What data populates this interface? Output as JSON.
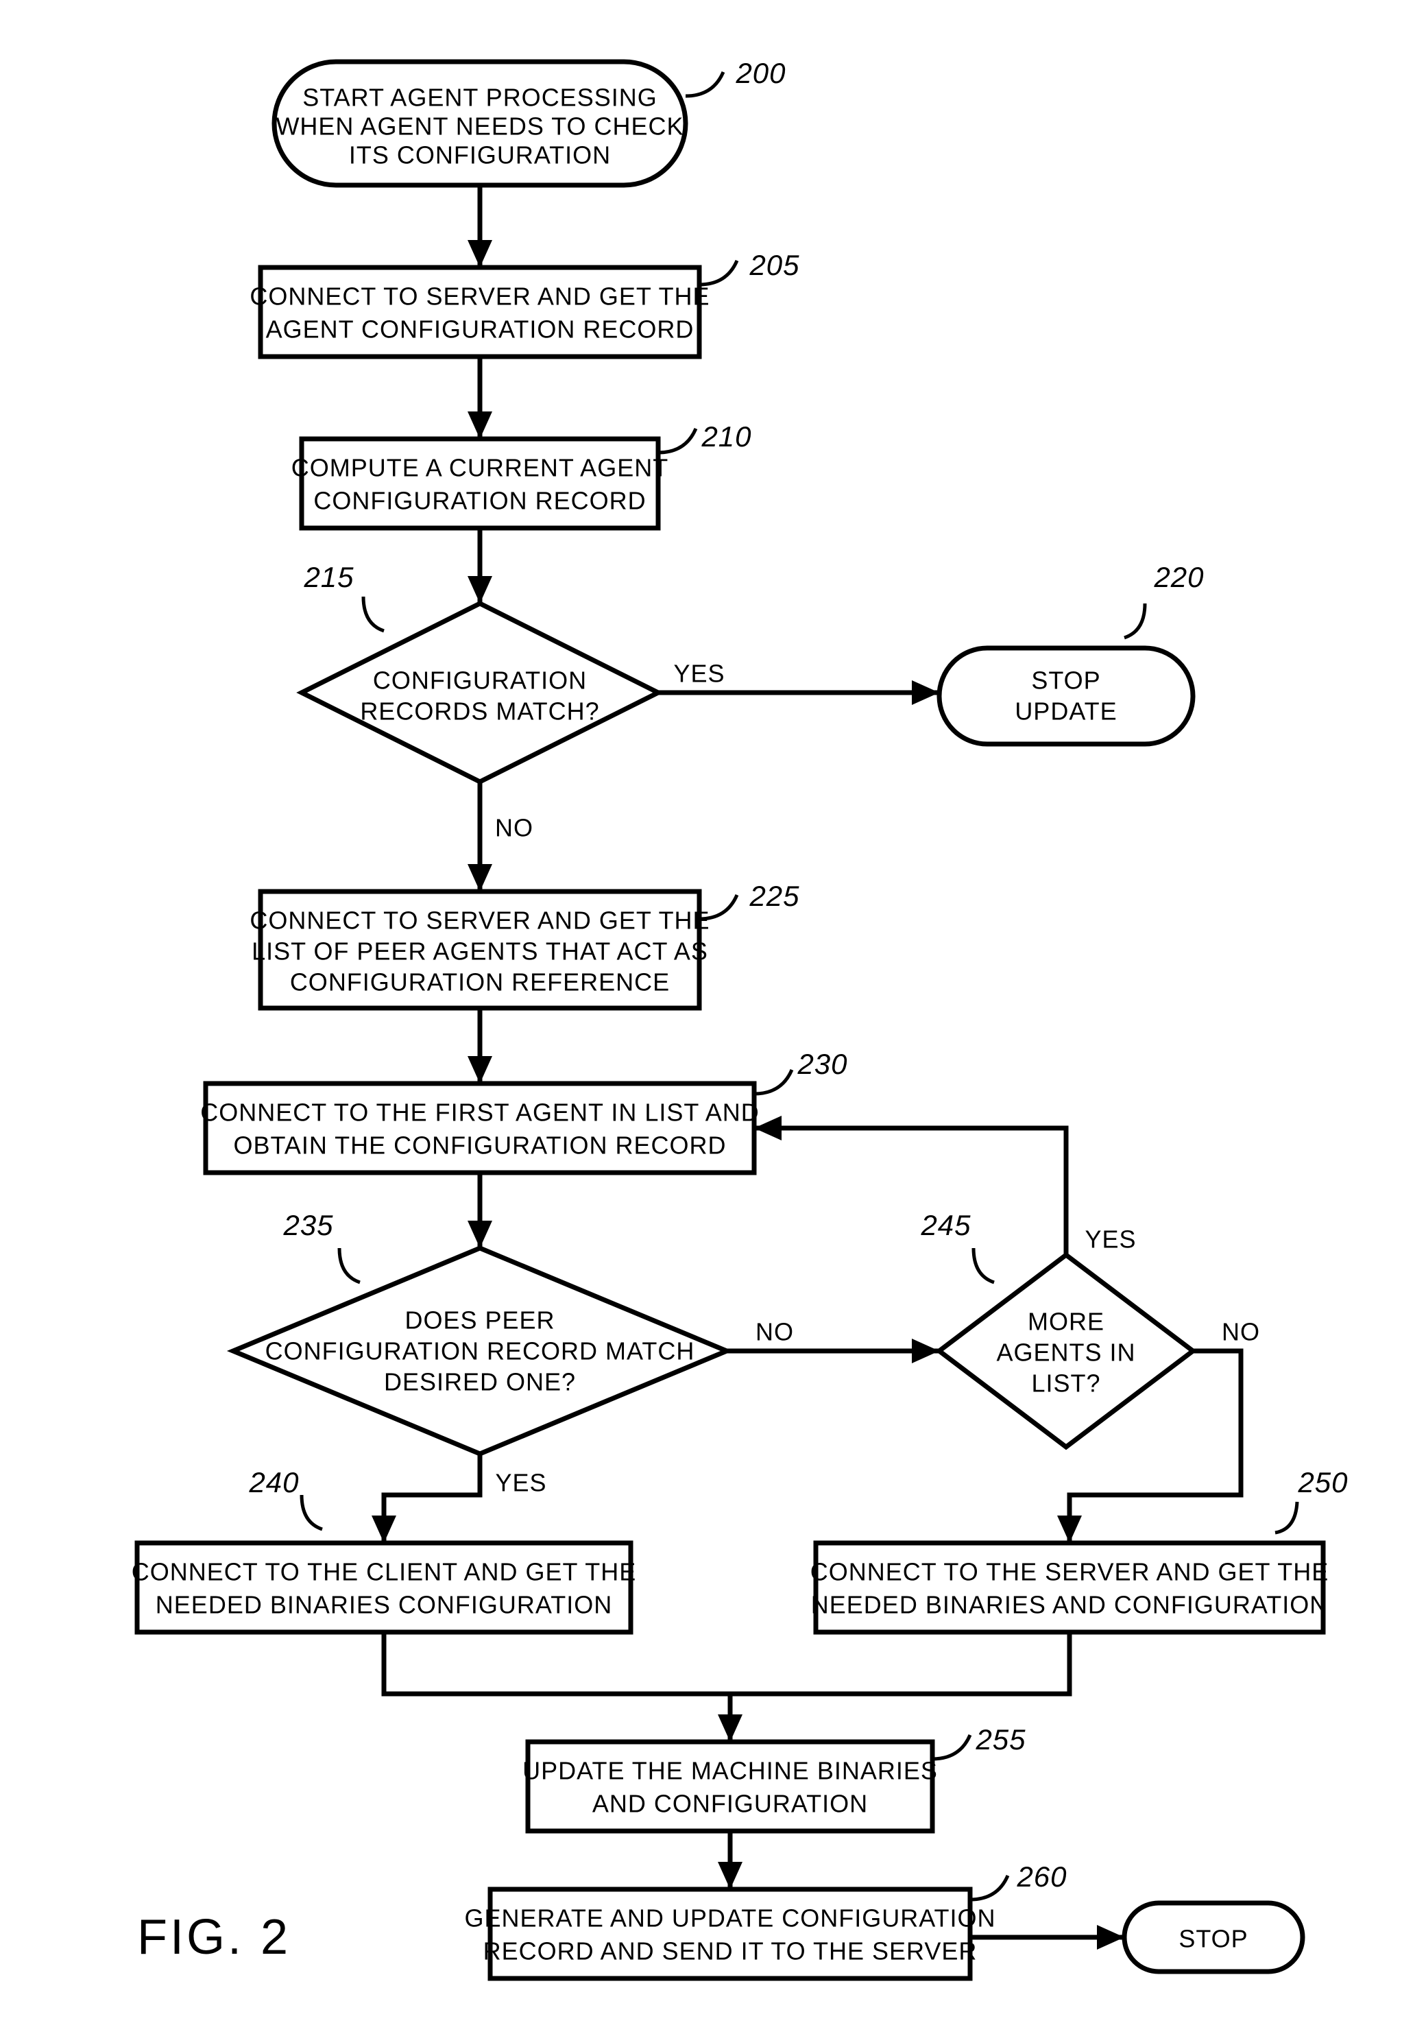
{
  "figure_label": "FIG. 2",
  "nodes": {
    "n200": {
      "ref": "200",
      "lines": [
        "START AGENT PROCESSING",
        "WHEN AGENT NEEDS TO CHECK",
        "ITS CONFIGURATION"
      ]
    },
    "n205": {
      "ref": "205",
      "lines": [
        "CONNECT TO SERVER AND GET THE",
        "AGENT CONFIGURATION RECORD"
      ]
    },
    "n210": {
      "ref": "210",
      "lines": [
        "COMPUTE A CURRENT AGENT",
        "CONFIGURATION RECORD"
      ]
    },
    "n215": {
      "ref": "215",
      "lines": [
        "CONFIGURATION",
        "RECORDS MATCH?"
      ]
    },
    "n220": {
      "ref": "220",
      "lines": [
        "STOP",
        "UPDATE"
      ]
    },
    "n225": {
      "ref": "225",
      "lines": [
        "CONNECT TO SERVER AND GET THE",
        "LIST OF PEER AGENTS THAT ACT AS",
        "CONFIGURATION REFERENCE"
      ]
    },
    "n230": {
      "ref": "230",
      "lines": [
        "CONNECT TO THE FIRST AGENT IN LIST AND",
        "OBTAIN THE CONFIGURATION RECORD"
      ]
    },
    "n235": {
      "ref": "235",
      "lines": [
        "DOES PEER",
        "CONFIGURATION RECORD MATCH",
        "DESIRED ONE?"
      ]
    },
    "n240": {
      "ref": "240",
      "lines": [
        "CONNECT TO THE CLIENT AND GET THE",
        "NEEDED BINARIES CONFIGURATION"
      ]
    },
    "n245": {
      "ref": "245",
      "lines": [
        "MORE",
        "AGENTS IN",
        "LIST?"
      ]
    },
    "n250": {
      "ref": "250",
      "lines": [
        "CONNECT TO THE SERVER AND GET THE",
        "NEEDED BINARIES AND CONFIGURATION"
      ]
    },
    "n255": {
      "ref": "255",
      "lines": [
        "UPDATE THE MACHINE BINARIES",
        "AND CONFIGURATION"
      ]
    },
    "n260": {
      "ref": "260",
      "lines": [
        "GENERATE AND UPDATE CONFIGURATION",
        "RECORD AND SEND IT TO THE SERVER"
      ]
    },
    "stop": {
      "lines": [
        "STOP"
      ]
    }
  },
  "edges": {
    "e215_yes": "YES",
    "e215_no": "NO",
    "e235_yes": "YES",
    "e235_no": "NO",
    "e245_yes": "YES",
    "e245_no": "NO"
  }
}
